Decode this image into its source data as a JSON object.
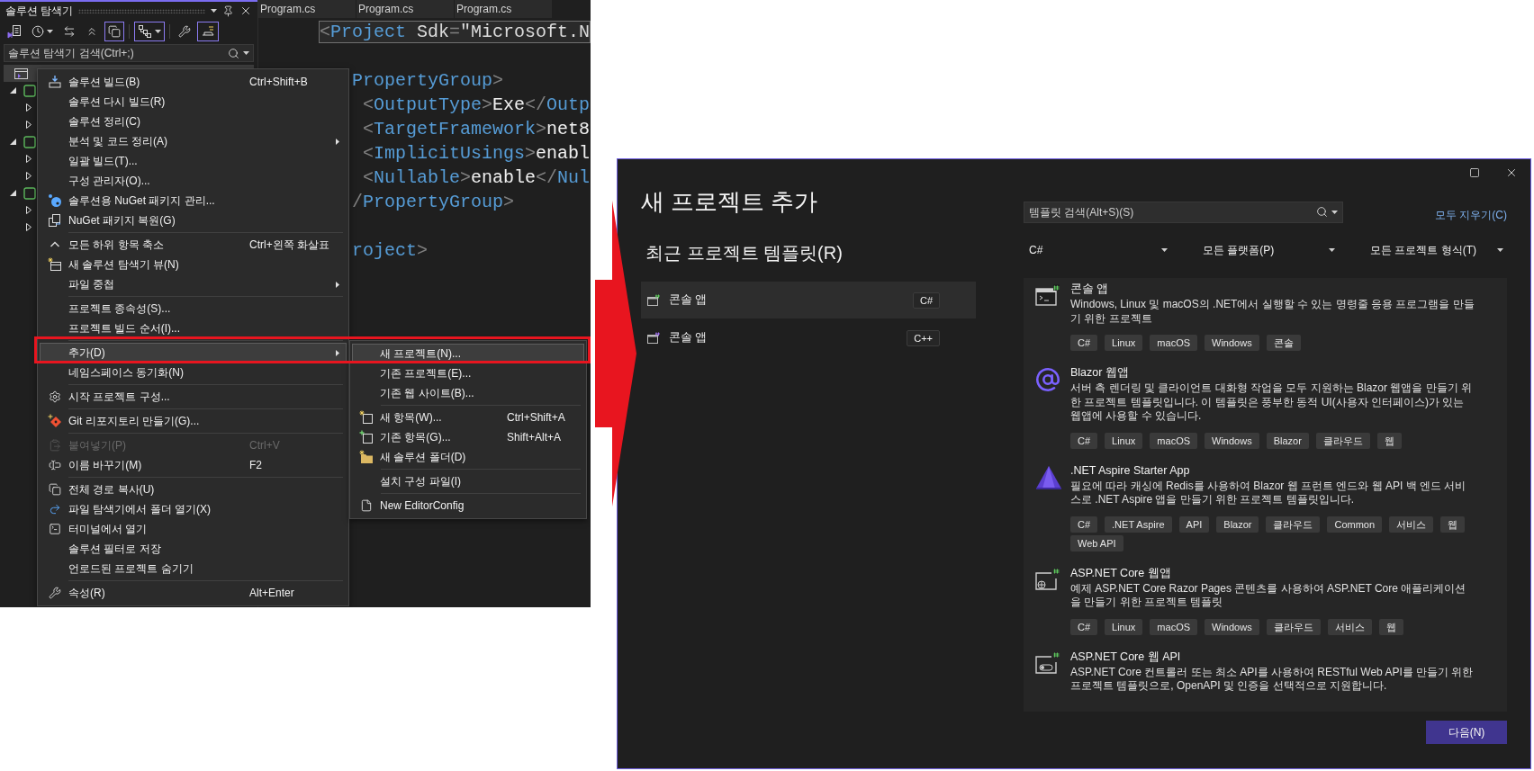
{
  "explorer": {
    "title": "솔루션 탐색기",
    "toolbar": [
      {
        "on": false
      },
      {
        "on": false
      },
      {
        "on": false
      },
      {
        "on": false
      },
      {
        "on": true
      },
      {
        "on": true
      },
      {
        "on": false
      },
      {
        "on": true
      }
    ],
    "search": {
      "placeholder": "솔루션 탐색기 검색(Ctrl+;)"
    },
    "tree": {
      "selected": true,
      "children": [
        {
          "expanded": true,
          "children": [
            {
              "expanded": false
            },
            {
              "expanded": false
            }
          ]
        },
        {
          "expanded": true,
          "children": [
            {
              "expanded": false
            },
            {
              "expanded": false
            }
          ]
        },
        {
          "expanded": true,
          "children": [
            {
              "expanded": false
            },
            {
              "expanded": false
            }
          ]
        }
      ]
    }
  },
  "editor": {
    "tabs": [
      "Program.cs",
      "Program.cs",
      "Program.cs"
    ],
    "lines": [
      {
        "kind": "code",
        "highlighted": true,
        "tokens": [
          {
            "kind": "punct",
            "text": "<"
          },
          {
            "kind": "tag",
            "text": "Project"
          },
          {
            "kind": "attr",
            "text": " Sdk"
          },
          {
            "kind": "punct",
            "text": "="
          },
          {
            "kind": "string",
            "text": "\"Microsoft.N"
          }
        ]
      },
      {
        "kind": "blank"
      },
      {
        "kind": "code",
        "highlighted": false,
        "tokens": [
          {
            "kind": "tag",
            "text": "   PropertyGroup"
          },
          {
            "kind": "punct",
            "text": ">"
          }
        ]
      },
      {
        "kind": "code",
        "highlighted": false,
        "tokens": [
          {
            "kind": "punct",
            "text": "    <"
          },
          {
            "kind": "tag",
            "text": "OutputType"
          },
          {
            "kind": "punct",
            "text": ">"
          },
          {
            "kind": "text",
            "text": "Exe"
          },
          {
            "kind": "punct",
            "text": "</"
          },
          {
            "kind": "tag",
            "text": "Outp"
          }
        ]
      },
      {
        "kind": "code",
        "highlighted": false,
        "tokens": [
          {
            "kind": "punct",
            "text": "    <"
          },
          {
            "kind": "tag",
            "text": "TargetFramework"
          },
          {
            "kind": "punct",
            "text": ">"
          },
          {
            "kind": "text",
            "text": "net8"
          }
        ]
      },
      {
        "kind": "code",
        "highlighted": false,
        "tokens": [
          {
            "kind": "punct",
            "text": "    <"
          },
          {
            "kind": "tag",
            "text": "ImplicitUsings"
          },
          {
            "kind": "punct",
            "text": ">"
          },
          {
            "kind": "text",
            "text": "enabl"
          }
        ]
      },
      {
        "kind": "code",
        "highlighted": false,
        "tokens": [
          {
            "kind": "punct",
            "text": "    <"
          },
          {
            "kind": "tag",
            "text": "Nullable"
          },
          {
            "kind": "punct",
            "text": ">"
          },
          {
            "kind": "text",
            "text": "enable"
          },
          {
            "kind": "punct",
            "text": "</"
          },
          {
            "kind": "tag",
            "text": "Nul"
          }
        ]
      },
      {
        "kind": "code",
        "highlighted": false,
        "tokens": [
          {
            "kind": "punct",
            "text": "   /"
          },
          {
            "kind": "tag",
            "text": "PropertyGroup"
          },
          {
            "kind": "punct",
            "text": ">"
          }
        ]
      },
      {
        "kind": "blank"
      },
      {
        "kind": "code",
        "highlighted": false,
        "tokens": [
          {
            "kind": "tag",
            "text": "   roject"
          },
          {
            "kind": "punct",
            "text": ">"
          }
        ]
      }
    ]
  },
  "context_menu": {
    "items": [
      {
        "kind": "item",
        "label": "솔루션 빌드(B)",
        "shortcut": "Ctrl+Shift+B",
        "submenu": false,
        "disabled": false,
        "selected": false
      },
      {
        "kind": "item",
        "label": "솔루션 다시 빌드(R)",
        "submenu": false,
        "disabled": false,
        "selected": false
      },
      {
        "kind": "item",
        "label": "솔루션 정리(C)",
        "submenu": false,
        "disabled": false,
        "selected": false
      },
      {
        "kind": "item",
        "label": "분석 및 코드 정리(A)",
        "submenu": true,
        "disabled": false,
        "selected": false
      },
      {
        "kind": "item",
        "label": "일괄 빌드(T)...",
        "submenu": false,
        "disabled": false,
        "selected": false
      },
      {
        "kind": "item",
        "label": "구성 관리자(O)...",
        "submenu": false,
        "disabled": false,
        "selected": false
      },
      {
        "kind": "item",
        "label": "솔루션용 NuGet 패키지 관리...",
        "submenu": false,
        "disabled": false,
        "selected": false
      },
      {
        "kind": "item",
        "label": "NuGet 패키지 복원(G)",
        "submenu": false,
        "disabled": false,
        "selected": false
      },
      {
        "kind": "separator"
      },
      {
        "kind": "item",
        "label": "모든 하위 항목 축소",
        "shortcut": "Ctrl+왼쪽 화살표",
        "submenu": false,
        "disabled": false,
        "selected": false
      },
      {
        "kind": "item",
        "label": "새 솔루션 탐색기 뷰(N)",
        "submenu": false,
        "disabled": false,
        "selected": false
      },
      {
        "kind": "item",
        "label": "파일 중첩",
        "submenu": true,
        "disabled": false,
        "selected": false
      },
      {
        "kind": "separator"
      },
      {
        "kind": "item",
        "label": "프로젝트 종속성(S)...",
        "submenu": false,
        "disabled": false,
        "selected": false
      },
      {
        "kind": "item",
        "label": "프로젝트 빌드 순서(I)...",
        "submenu": false,
        "disabled": false,
        "selected": false
      },
      {
        "kind": "separator"
      },
      {
        "kind": "item",
        "label": "추가(D)",
        "submenu": true,
        "disabled": false,
        "selected": true
      },
      {
        "kind": "item",
        "label": "네임스페이스 동기화(N)",
        "submenu": false,
        "disabled": false,
        "selected": false
      },
      {
        "kind": "separator"
      },
      {
        "kind": "item",
        "label": "시작 프로젝트 구성...",
        "submenu": false,
        "disabled": false,
        "selected": false
      },
      {
        "kind": "separator"
      },
      {
        "kind": "item",
        "label": "Git 리포지토리 만들기(G)...",
        "submenu": false,
        "disabled": false,
        "selected": false
      },
      {
        "kind": "separator"
      },
      {
        "kind": "item",
        "label": "붙여넣기(P)",
        "shortcut": "Ctrl+V",
        "submenu": false,
        "disabled": true,
        "selected": false
      },
      {
        "kind": "item",
        "label": "이름 바꾸기(M)",
        "shortcut": "F2",
        "submenu": false,
        "disabled": false,
        "selected": false
      },
      {
        "kind": "separator"
      },
      {
        "kind": "item",
        "label": "전체 경로 복사(U)",
        "submenu": false,
        "disabled": false,
        "selected": false
      },
      {
        "kind": "item",
        "label": "파일 탐색기에서 폴더 열기(X)",
        "submenu": false,
        "disabled": false,
        "selected": false
      },
      {
        "kind": "item",
        "label": "터미널에서 열기",
        "submenu": false,
        "disabled": false,
        "selected": false
      },
      {
        "kind": "item",
        "label": "솔루션 필터로 저장",
        "submenu": false,
        "disabled": false,
        "selected": false
      },
      {
        "kind": "item",
        "label": "언로드된 프로젝트 숨기기",
        "submenu": false,
        "disabled": false,
        "selected": false
      },
      {
        "kind": "separator"
      },
      {
        "kind": "item",
        "label": "속성(R)",
        "shortcut": "Alt+Enter",
        "submenu": false,
        "disabled": false,
        "selected": false
      }
    ]
  },
  "submenu": {
    "items": [
      {
        "kind": "item",
        "label": "새 프로젝트(N)...",
        "selected": true
      },
      {
        "kind": "item",
        "label": "기존 프로젝트(E)...",
        "selected": false
      },
      {
        "kind": "item",
        "label": "기존 웹 사이트(B)...",
        "selected": false
      },
      {
        "kind": "separator"
      },
      {
        "kind": "item",
        "label": "새 항목(W)...",
        "shortcut": "Ctrl+Shift+A",
        "selected": false
      },
      {
        "kind": "item",
        "label": "기존 항목(G)...",
        "shortcut": "Shift+Alt+A",
        "selected": false
      },
      {
        "kind": "item",
        "label": "새 솔루션 폴더(D)",
        "selected": false
      },
      {
        "kind": "separator"
      },
      {
        "kind": "item",
        "label": "설치 구성 파일(I)",
        "selected": false
      },
      {
        "kind": "separator"
      },
      {
        "kind": "item",
        "label": "New EditorConfig",
        "selected": false
      }
    ]
  },
  "dialog": {
    "title": "새 프로젝트 추가",
    "recent_heading": "최근 프로젝트 템플릿(R)",
    "recent": [
      {
        "name": "콘솔 앱",
        "language": "C#",
        "selected": true
      },
      {
        "name": "콘솔 앱",
        "language": "C++",
        "selected": false
      }
    ],
    "search": {
      "placeholder": "템플릿 검색(Alt+S)(S)"
    },
    "clear_link": "모두 지우기(C)",
    "filters": [
      "C#",
      "모든 플랫폼(P)",
      "모든 프로젝트 형식(T)"
    ],
    "templates": [
      {
        "title": "콘솔 앱",
        "description": "Windows, Linux 및 macOS의 .NET에서 실행할 수 있는 명령줄 응용 프로그램을 만들기 위한 프로젝트",
        "tags": [
          "C#",
          "Linux",
          "macOS",
          "Windows",
          "콘솔"
        ]
      },
      {
        "title": "Blazor 웹앱",
        "description": "서버 측 렌더링 및 클라이언트 대화형 작업을 모두 지원하는 Blazor 웹앱을 만들기 위한 프로젝트 템플릿입니다. 이 템플릿은 풍부한 동적 UI(사용자 인터페이스)가 있는 웹앱에 사용할 수 있습니다.",
        "tags": [
          "C#",
          "Linux",
          "macOS",
          "Windows",
          "Blazor",
          "클라우드",
          "웹"
        ]
      },
      {
        "title": ".NET Aspire Starter App",
        "description": "필요에 따라 캐싱에 Redis를 사용하여 Blazor 웹 프런트 엔드와 웹 API 백 엔드 서비스로 .NET Aspire 앱을 만들기 위한 프로젝트 템플릿입니다.",
        "tags": [
          "C#",
          ".NET Aspire",
          "API",
          "Blazor",
          "클라우드",
          "Common",
          "서비스",
          "웹",
          "Web API"
        ]
      },
      {
        "title": "ASP.NET Core 웹앱",
        "description": "예제 ASP.NET Core Razor Pages 콘텐츠를 사용하여 ASP.NET Core 애플리케이션을 만들기 위한 프로젝트 템플릿",
        "tags": [
          "C#",
          "Linux",
          "macOS",
          "Windows",
          "클라우드",
          "서비스",
          "웹"
        ]
      },
      {
        "title": "ASP.NET Core 웹 API",
        "description": "ASP.NET Core 컨트롤러 또는 최소 API를 사용하여 RESTful Web API를 만들기 위한 프로젝트 템플릿으로, OpenAPI 및 인증을 선택적으로 지원합니다."
      }
    ],
    "next_button": "다음(N)"
  }
}
